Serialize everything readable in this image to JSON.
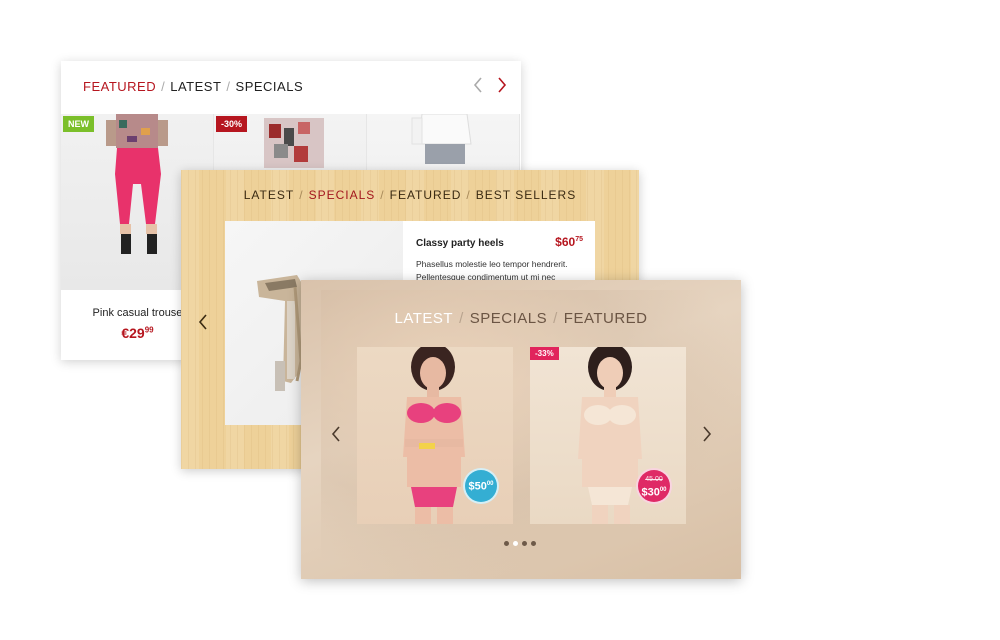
{
  "colors": {
    "accent_red": "#b6161f",
    "badge_new": "#7bbf2a",
    "badge_pink": "#e1245c",
    "price_blue": "#34aed3",
    "price_red": "#df2a66",
    "wood": "#eed199"
  },
  "card1": {
    "tabs": [
      "FEATURED",
      "LATEST",
      "SPECIALS"
    ],
    "separator": "/",
    "active_tab": "FEATURED",
    "prev_icon": "chevron-left-icon",
    "next_icon": "chevron-right-icon",
    "products": [
      {
        "badge": "NEW",
        "name": "Pink casual trouse",
        "price_main": "€29",
        "price_cents": "99"
      },
      {
        "badge": "-30%"
      },
      {
        "badge": ""
      }
    ]
  },
  "card2": {
    "tabs": [
      "LATEST",
      "SPECIALS",
      "FEATURED",
      "BEST SELLERS"
    ],
    "separator": "/",
    "active_tab": "SPECIALS",
    "product": {
      "name": "Classy party heels",
      "price_main": "$60",
      "price_cents": "75",
      "description": "Phasellus molestie leo tempor hendrerit. Pellentesque condimentum ut mi nec"
    },
    "prev_icon": "chevron-left-icon"
  },
  "card3": {
    "tabs": [
      "LATEST",
      "SPECIALS",
      "FEATURED"
    ],
    "separator": "/",
    "active_tab": "LATEST",
    "products": [
      {
        "badge": "",
        "price_main": "$50",
        "price_cents": "00"
      },
      {
        "badge": "-33%",
        "old_price": "45.00",
        "price_main": "$30",
        "price_cents": "00"
      }
    ],
    "dots_total": 4,
    "dot_active_index": 1,
    "prev_icon": "chevron-left-icon",
    "next_icon": "chevron-right-icon"
  }
}
